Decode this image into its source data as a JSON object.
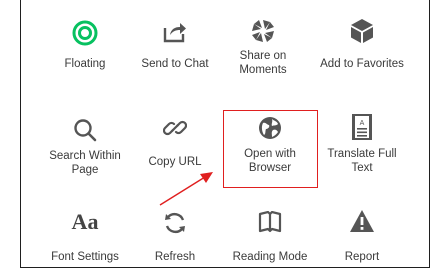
{
  "menu": {
    "items": [
      {
        "label": "Floating",
        "icon": "floating-ring-icon"
      },
      {
        "label": "Send to Chat",
        "icon": "share-arrow-icon"
      },
      {
        "label": "Share on\nMoments",
        "icon": "moments-aperture-icon"
      },
      {
        "label": "Add to Favorites",
        "icon": "favorites-cube-icon"
      },
      {
        "label": "Search Within\nPage",
        "icon": "search-icon"
      },
      {
        "label": "Copy URL",
        "icon": "link-icon"
      },
      {
        "label": "Open with\nBrowser",
        "icon": "globe-icon"
      },
      {
        "label": "Translate Full\nText",
        "icon": "translate-document-icon"
      },
      {
        "label": "Font Settings",
        "icon": "font-aa-icon"
      },
      {
        "label": "Refresh",
        "icon": "refresh-icon"
      },
      {
        "label": "Reading Mode",
        "icon": "book-icon"
      },
      {
        "label": "Report",
        "icon": "warning-icon"
      }
    ]
  },
  "glyphs": {
    "font": "Aa"
  },
  "colors": {
    "accent_green": "#07c160",
    "highlight": "#e01f1f",
    "icon_gray": "#555555"
  }
}
